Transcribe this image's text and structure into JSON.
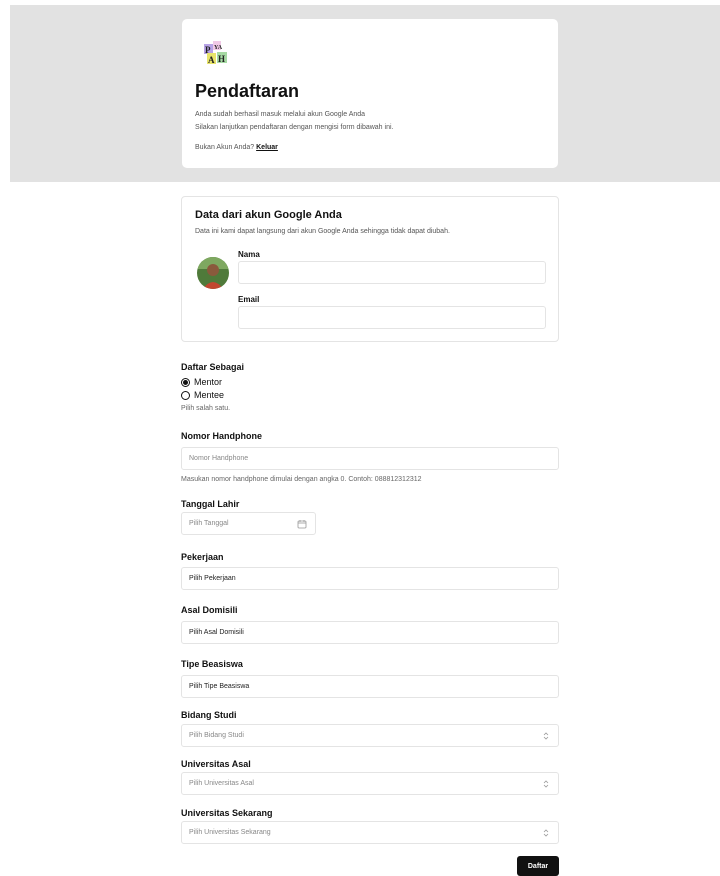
{
  "header": {
    "title": "Pendaftaran",
    "line1": "Anda sudah berhasil masuk melalui akun Google Anda",
    "line2": "Silakan lanjutkan pendaftaran dengan mengisi form dibawah ini.",
    "not_you": "Bukan Akun Anda?",
    "logout": "Keluar",
    "logo_icon": "brand-logo-icon"
  },
  "google": {
    "title": "Data dari akun Google Anda",
    "subtitle": "Data ini kami dapat langsung dari akun Google Anda sehingga tidak dapat diubah.",
    "name_label": "Nama",
    "name_value": "",
    "email_label": "Email",
    "email_value": ""
  },
  "role": {
    "label": "Daftar Sebagai",
    "options": [
      "Mentor",
      "Mentee"
    ],
    "selected": "Mentor",
    "help": "Pilih salah satu."
  },
  "phone": {
    "label": "Nomor Handphone",
    "placeholder": "Nomor Handphone",
    "help": "Masukan nomor handphone dimulai dengan angka 0. Contoh: 088812312312"
  },
  "birth": {
    "label": "Tanggal Lahir",
    "placeholder": "Pilih Tanggal"
  },
  "job": {
    "label": "Pekerjaan",
    "value": "Pilih Pekerjaan"
  },
  "domicile": {
    "label": "Asal Domisili",
    "value": "Pilih Asal Domisili"
  },
  "scholarship": {
    "label": "Tipe Beasiswa",
    "value": "Pilih Tipe Beasiswa"
  },
  "study": {
    "label": "Bidang Studi",
    "value": "Pilih Bidang Studi"
  },
  "origin_univ": {
    "label": "Universitas Asal",
    "value": "Pilih Universitas Asal"
  },
  "current_univ": {
    "label": "Universitas Sekarang",
    "value": "Pilih Universitas Sekarang"
  },
  "submit": "Daftar"
}
